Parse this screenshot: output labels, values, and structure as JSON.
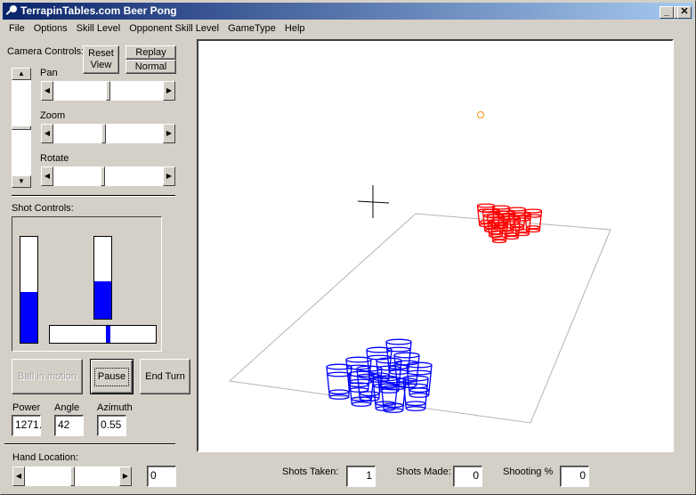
{
  "window": {
    "title": "TerrapinTables.com Beer Pong",
    "controls": {
      "minimize": "_",
      "maximize": "□",
      "close": "✕"
    }
  },
  "menu": [
    "File",
    "Options",
    "Skill Level",
    "Opponent Skill Level",
    "GameType",
    "Help"
  ],
  "camera": {
    "label": "Camera Controls:",
    "reset_line1": "Reset",
    "reset_line2": "View",
    "replay": "Replay",
    "normal": "Normal",
    "pan_label": "Pan",
    "zoom_label": "Zoom",
    "rotate_label": "Rotate",
    "pan_value": 0.5,
    "zoom_value": 0.46,
    "rotate_value": 0.45,
    "vertical_value": 0.5
  },
  "shot": {
    "label": "Shot Controls:",
    "power_meter": 0.48,
    "angle_meter": 0.46,
    "azimuth_meter": 0.55,
    "ball_in_motion": "Ball in motion",
    "pause": "Pause",
    "end_turn": "End Turn",
    "power_label": "Power",
    "angle_label": "Angle",
    "azimuth_label": "Azimuth",
    "power_value": "1271.",
    "angle_value": "42",
    "azimuth_value": "0.55"
  },
  "hand": {
    "label": "Hand Location:",
    "slider_value": 0.5,
    "value": "0"
  },
  "stats": {
    "shots_taken_label": "Shots Taken:",
    "shots_taken": "1",
    "shots_made_label": "Shots Made:",
    "shots_made": "0",
    "shooting_pct_label": "Shooting %",
    "shooting_pct": "0"
  },
  "scene": {
    "player_cup_color": "#0000ff",
    "opponent_cup_color": "#ff0000",
    "ball_color": "#ff8c00",
    "table_color": "#b4b4b4",
    "crosshair_color": "#000000"
  }
}
